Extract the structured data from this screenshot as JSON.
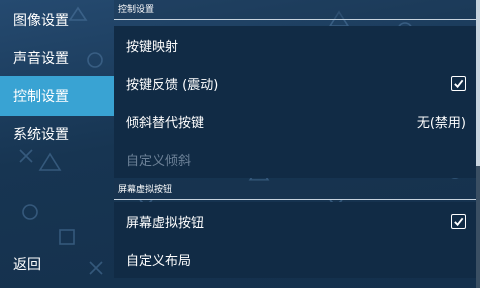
{
  "sidebar": {
    "items": [
      {
        "label": "图像设置"
      },
      {
        "label": "声音设置"
      },
      {
        "label": "控制设置"
      },
      {
        "label": "系统设置"
      }
    ],
    "back_label": "返回"
  },
  "sections": [
    {
      "title": "控制设置",
      "rows": [
        {
          "label": "按键映射"
        },
        {
          "label": "按键反馈 (震动)",
          "checked": true
        },
        {
          "label": "倾斜替代按键",
          "value": "无(禁用)"
        },
        {
          "label": "自定义倾斜",
          "disabled": true
        }
      ]
    },
    {
      "title": "屏幕虚拟按钮",
      "rows": [
        {
          "label": "屏幕虚拟按钮",
          "checked": true
        },
        {
          "label": "自定义布局"
        }
      ]
    }
  ],
  "colors": {
    "accent": "#39a3d3",
    "background": "#1a3550",
    "row_background": "#112b45",
    "disabled_text": "#6c8197"
  },
  "icons": {
    "background_pattern": "playstation-symbols",
    "check": "checkmark-icon"
  }
}
